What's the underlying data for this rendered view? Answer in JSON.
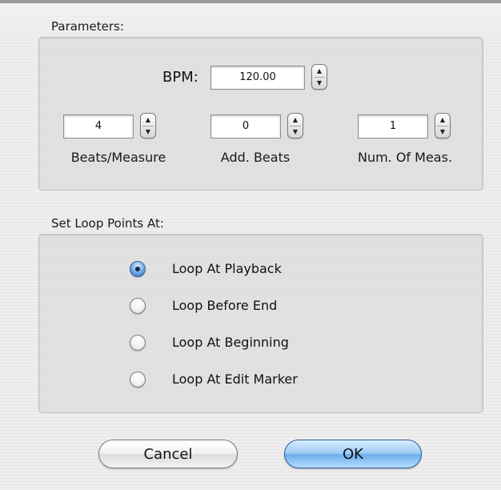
{
  "parameters": {
    "label": "Parameters:",
    "bpm_label": "BPM:",
    "bpm_value": "120.00",
    "fields": [
      {
        "value": "4",
        "caption": "Beats/Measure"
      },
      {
        "value": "0",
        "caption": "Add. Beats"
      },
      {
        "value": "1",
        "caption": "Num. Of Meas."
      }
    ]
  },
  "loop": {
    "label": "Set Loop Points At:",
    "options": [
      {
        "label": "Loop At Playback",
        "selected": true
      },
      {
        "label": "Loop Before End",
        "selected": false
      },
      {
        "label": "Loop At Beginning",
        "selected": false
      },
      {
        "label": "Loop At Edit Marker",
        "selected": false
      }
    ]
  },
  "buttons": {
    "cancel": "Cancel",
    "ok": "OK"
  },
  "icons": {
    "stepper_up": "triangle-up",
    "stepper_down": "triangle-down"
  },
  "colors": {
    "default_button": "#6cacec",
    "radio_selected": "#2f6fc5"
  }
}
